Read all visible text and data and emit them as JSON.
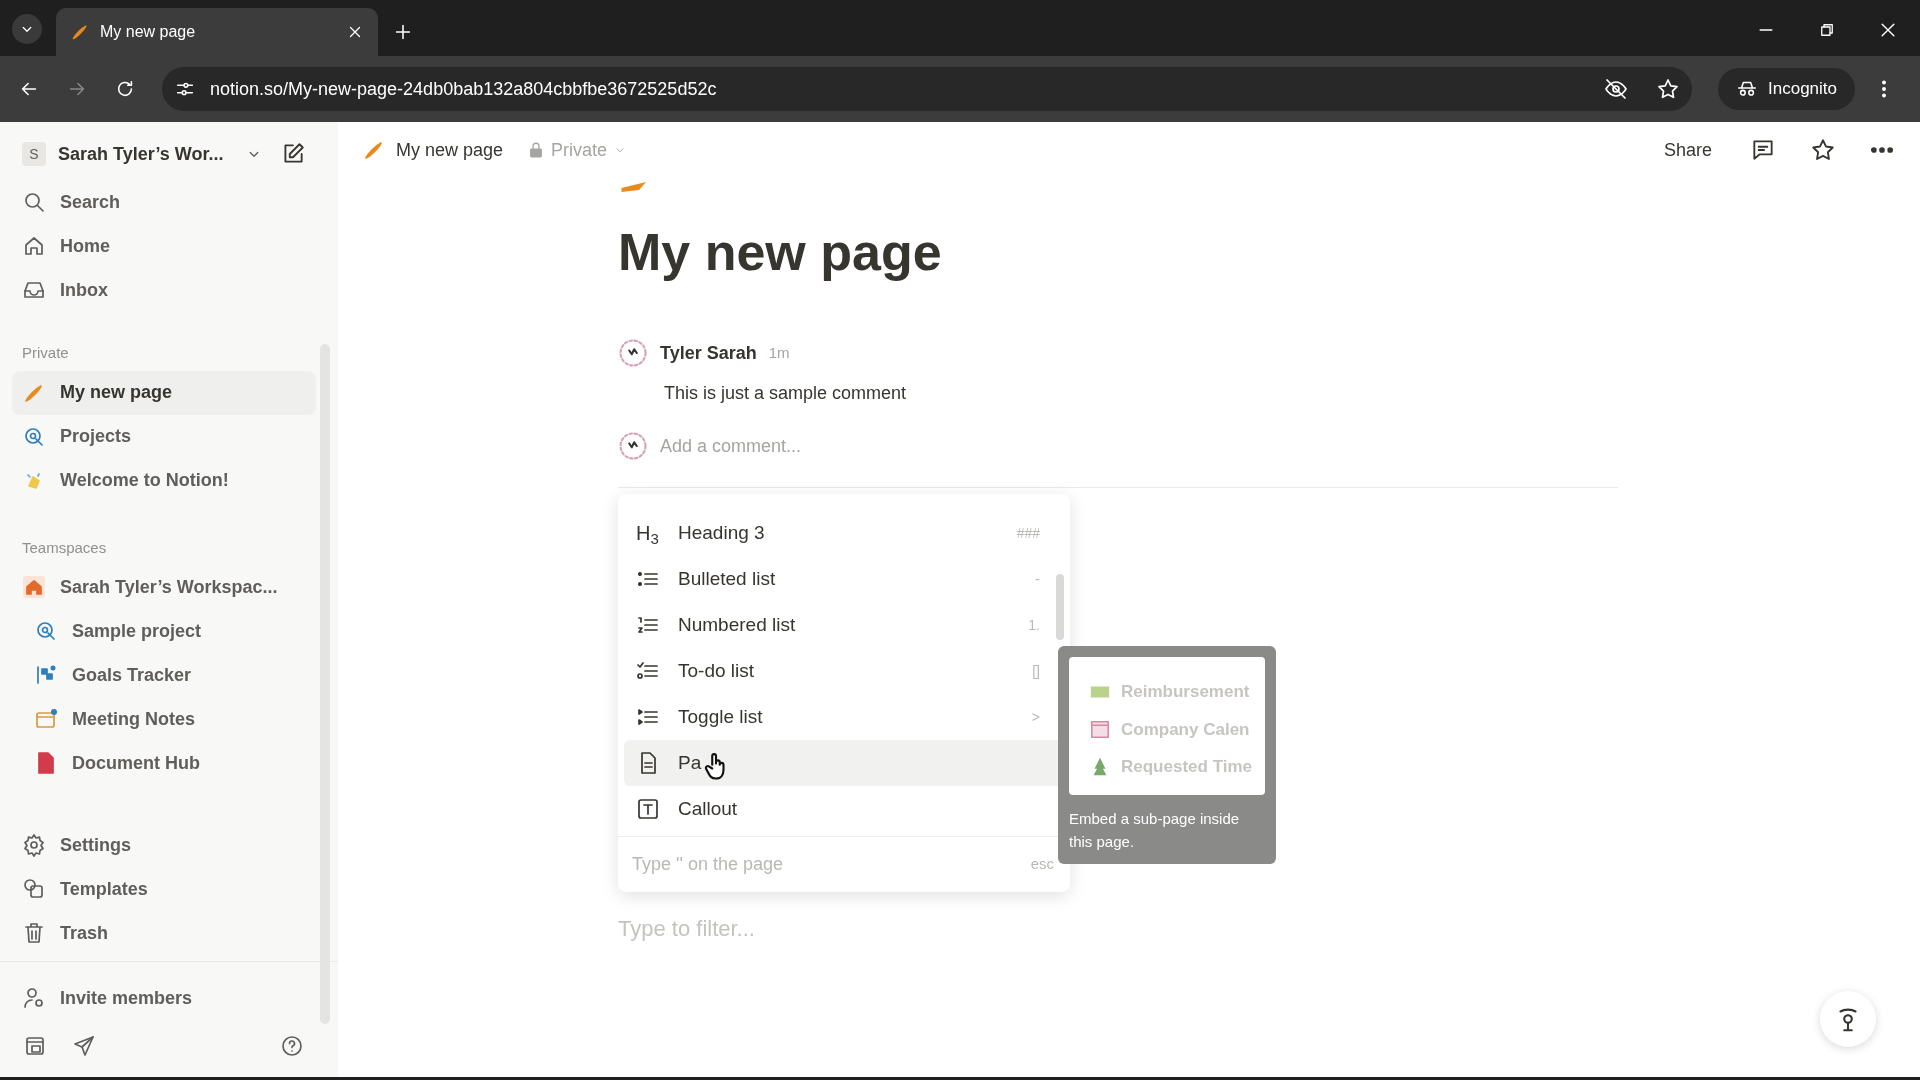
{
  "browser": {
    "tab_title": "My new page",
    "url": "notion.so/My-new-page-24db0bab132a804cbbfbe3672525d52c",
    "incognito_label": "Incognito"
  },
  "sidebar": {
    "workspace": {
      "avatar_letter": "S",
      "name": "Sarah Tyler’s Wor..."
    },
    "nav": [
      {
        "label": "Search"
      },
      {
        "label": "Home"
      },
      {
        "label": "Inbox"
      }
    ],
    "sections": [
      {
        "label": "Private",
        "items": [
          {
            "label": "My new page",
            "selected": true
          },
          {
            "label": "Projects",
            "selected": false
          },
          {
            "label": "Welcome to Notion!",
            "selected": false
          }
        ]
      },
      {
        "label": "Teamspaces",
        "items": [
          {
            "label": "Sarah Tyler’s Workspac...",
            "selected": false,
            "children": [
              {
                "label": "Sample project",
                "selected": false
              },
              {
                "label": "Goals Tracker",
                "selected": false
              },
              {
                "label": "Meeting Notes",
                "selected": false
              },
              {
                "label": "Document Hub",
                "selected": false
              }
            ]
          }
        ]
      }
    ],
    "bottom": [
      {
        "label": "Settings"
      },
      {
        "label": "Templates"
      },
      {
        "label": "Trash"
      }
    ],
    "invite": "Invite members"
  },
  "topbar": {
    "breadcrumb": "My new page",
    "privacy": "Private",
    "share": "Share"
  },
  "page": {
    "title": "My new page",
    "comments": [
      {
        "author": "Tyler Sarah",
        "time": "1m",
        "text": "This is just a sample comment"
      }
    ],
    "add_comment_placeholder": "Add a comment...",
    "menu": {
      "items": [
        {
          "label": "Heading 3",
          "icon_glyph": "H$_{3}$",
          "shortcut": "###",
          "selected": false
        },
        {
          "label": "Bulleted list",
          "shortcut": "-",
          "selected": false
        },
        {
          "label": "Numbered list",
          "shortcut": "1.",
          "selected": false
        },
        {
          "label": "To-do list",
          "shortcut": "[]",
          "selected": false
        },
        {
          "label": "Toggle list",
          "shortcut": ">",
          "selected": false
        },
        {
          "label": "Pa",
          "selected": true
        },
        {
          "label": "Callout",
          "selected": false
        }
      ],
      "footer_hint": "Type '' on the page",
      "footer_key": "esc"
    },
    "tooltip": {
      "preview_items": [
        "Reimbursement",
        "Company Calen",
        "Requested Time"
      ],
      "description": "Embed a sub-page inside this page."
    },
    "filter_placeholder": "Type to filter..."
  }
}
